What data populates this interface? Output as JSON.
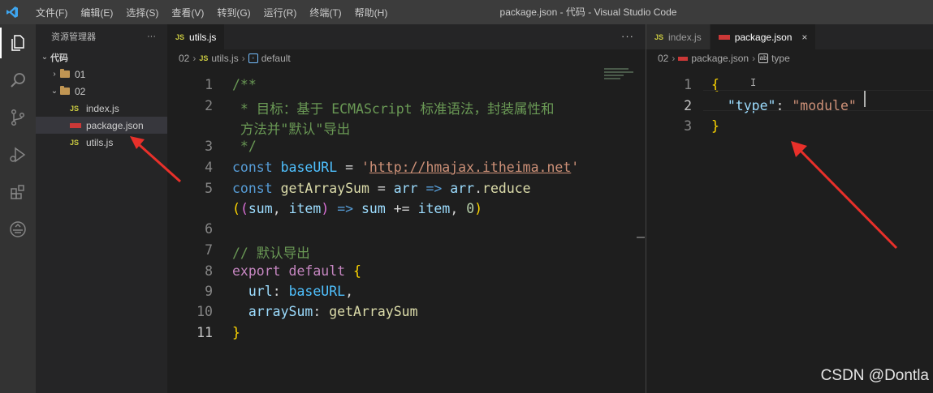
{
  "titlebar": {
    "menu": [
      "文件(F)",
      "编辑(E)",
      "选择(S)",
      "查看(V)",
      "转到(G)",
      "运行(R)",
      "终端(T)",
      "帮助(H)"
    ],
    "window_title": "package.json - 代码 - Visual Studio Code"
  },
  "activity_bar": {
    "icons": [
      "files-icon",
      "search-icon",
      "source-control-icon",
      "run-debug-icon",
      "extensions-icon",
      "remote-icon"
    ]
  },
  "sidebar": {
    "title": "资源管理器",
    "more": "···",
    "root": "代码",
    "items": [
      {
        "label": "01",
        "type": "folder",
        "expanded": false
      },
      {
        "label": "02",
        "type": "folder",
        "expanded": true
      },
      {
        "label": "index.js",
        "type": "js"
      },
      {
        "label": "package.json",
        "type": "json",
        "selected": true
      },
      {
        "label": "utils.js",
        "type": "js"
      }
    ]
  },
  "editor_left": {
    "tab": {
      "label": "utils.js",
      "icon": "JS"
    },
    "more": "···",
    "breadcrumb": [
      "02",
      "utils.js",
      "default"
    ],
    "line_numbers": [
      "1",
      "2",
      "3",
      "4",
      "5",
      "6",
      "7",
      "8",
      "9",
      "10",
      "11"
    ],
    "code": {
      "l1": "/**",
      "l2a": " * 目标：基于 ECMAScript 标准语法，封装属性和",
      "l2b": " 方法并\"默认\"导出",
      "l3": " */",
      "const": "const",
      "baseURL": "baseURL",
      "eq": " = ",
      "url_q": "'",
      "url": "http://hmajax.itheima.net",
      "getArraySum": "getArraySum",
      "arr": "arr",
      "arrow": "=>",
      "reduce_obj": "arr",
      "reduce": "reduce",
      "sum": "sum",
      "item": "item",
      "pluseq": " += ",
      "zero": "0",
      "comment2": "// 默认导出",
      "export": "export",
      "default": "default",
      "url_key": "url",
      "arraySum_key": "arraySum"
    }
  },
  "editor_right": {
    "tabs": [
      {
        "label": "index.js",
        "icon": "JS",
        "active": false
      },
      {
        "label": "package.json",
        "icon": "npm",
        "active": true,
        "close": "×"
      }
    ],
    "breadcrumb": [
      "02",
      "package.json",
      "type"
    ],
    "line_numbers": [
      "1",
      "2",
      "3"
    ],
    "code": {
      "open": "{",
      "key": "\"type\"",
      "colon": ": ",
      "value": "\"module\"",
      "close": "}"
    }
  },
  "watermark": "CSDN @Dontla",
  "colors": {
    "annotation_arrow": "#e8302a",
    "titlebar": "#3c3c3c",
    "activity_bar": "#333333",
    "sidebar": "#252526",
    "editor": "#1e1e1e"
  }
}
